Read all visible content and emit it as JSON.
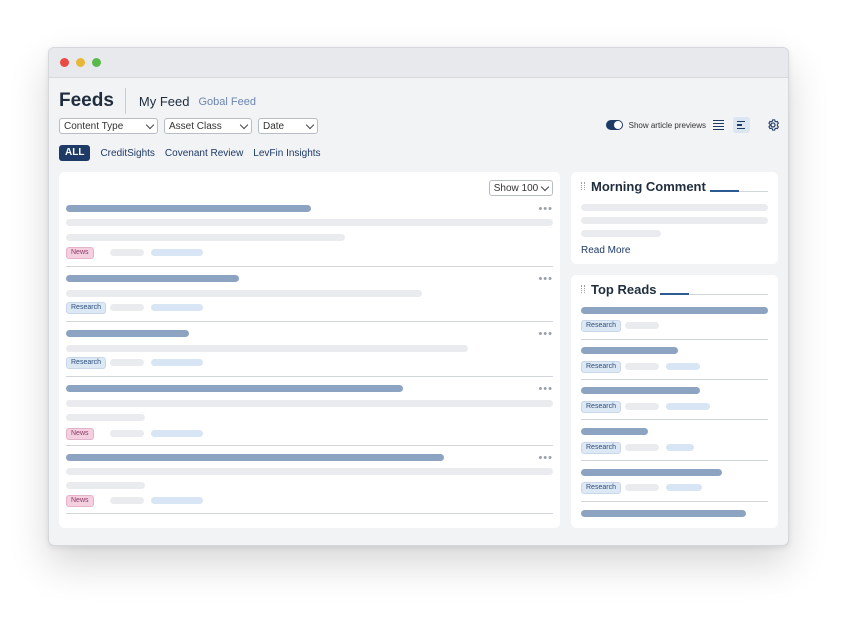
{
  "header": {
    "title": "Feeds",
    "my_feed": "My Feed",
    "global_feed": "Gobal Feed"
  },
  "filters": [
    {
      "label": "Content Type"
    },
    {
      "label": "Asset Class"
    },
    {
      "label": "Date"
    }
  ],
  "controls": {
    "preview_label": "Show article previews",
    "preview_enabled": true
  },
  "tabs": {
    "all": "ALL",
    "items": [
      "CreditSights",
      "Covenant Review",
      "LevFin Insights"
    ]
  },
  "feed": {
    "show_label": "Show 100",
    "more": "•••",
    "items": [
      {
        "badge": "News"
      },
      {
        "badge": "Research"
      },
      {
        "badge": "Research"
      },
      {
        "badge": "News"
      },
      {
        "badge": "News"
      }
    ]
  },
  "morning_comment": {
    "title": "Morning Comment",
    "read_more": "Read More"
  },
  "top_reads": {
    "title": "Top Reads",
    "items": [
      {
        "badge": "Research"
      },
      {
        "badge": "Research"
      },
      {
        "badge": "Research"
      },
      {
        "badge": "Research"
      },
      {
        "badge": "Research"
      }
    ]
  },
  "colors": {
    "accent": "#1e3a66",
    "title_bar": "#8da3c2",
    "news_badge": "#f3cfe0",
    "research_badge": "#dde8f5"
  }
}
